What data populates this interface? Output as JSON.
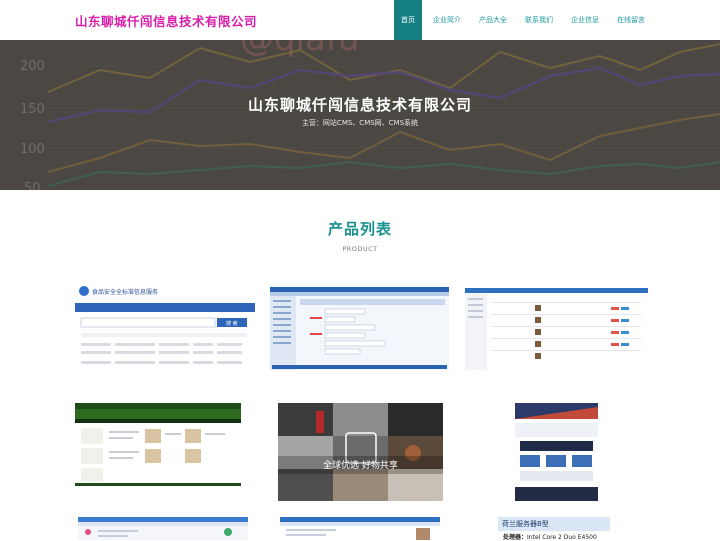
{
  "header": {
    "brand": "山东聊城仟闯信息技术有限公司",
    "nav": [
      {
        "label": "首页",
        "active": true
      },
      {
        "label": "企业简介"
      },
      {
        "label": "产品大全"
      },
      {
        "label": "联系我们"
      },
      {
        "label": "企业信息"
      },
      {
        "label": "在线留言"
      }
    ]
  },
  "hero": {
    "title": "山东聊城仟闯信息技术有限公司",
    "subtitle": "主营：网站CMS、CMS网、CMS系统",
    "bg_chart_ticks": [
      "200",
      "150",
      "100",
      "50"
    ],
    "watermark": "@qiafu"
  },
  "section": {
    "title": "产品列表",
    "subtitle": "PRODUCT"
  },
  "products": {
    "p1_title": "食品安全全标准信息服务",
    "p1_button": "搜 索",
    "p5_overlay": "全球优选 好物共享",
    "server_title": "荷兰服务器B型",
    "server_spec_label": "处理器：",
    "server_spec_value": "Intel Core 2 Duo E4500"
  },
  "colors": {
    "brand": "#d61ea8",
    "accent": "#157f84",
    "section_title": "#16918e"
  }
}
